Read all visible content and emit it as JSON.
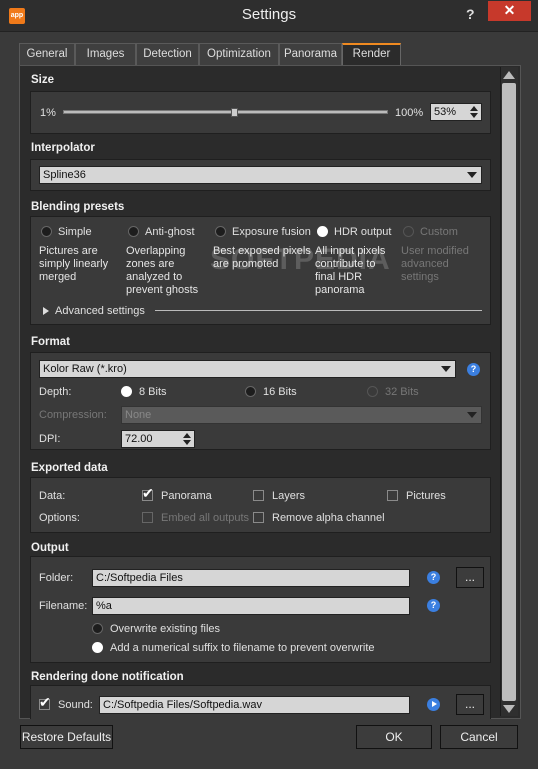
{
  "window": {
    "title": "Settings",
    "help": "?",
    "close": "✕",
    "icon": "app-icon",
    "icon_text": "app"
  },
  "tabs": [
    "General",
    "Images",
    "Detection",
    "Optimization",
    "Panorama",
    "Render"
  ],
  "active_tab": "Render",
  "watermark": "SOFTPEDIA",
  "size": {
    "title": "Size",
    "min_label": "1%",
    "max_label": "100%",
    "value": "53%",
    "level_percent": 53
  },
  "interpolator": {
    "title": "Interpolator",
    "selected": "Spline36"
  },
  "blending": {
    "title": "Blending presets",
    "options": [
      {
        "label": "Simple",
        "desc": [
          "Pictures are",
          "simply linearly",
          "merged"
        ]
      },
      {
        "label": "Anti-ghost",
        "desc": [
          "Overlapping",
          "zones are",
          "analyzed to",
          "prevent ghosts"
        ]
      },
      {
        "label": "Exposure fusion",
        "desc": [
          "Best exposed pixels",
          "are promoted"
        ]
      },
      {
        "label": "HDR output",
        "desc": [
          "All input pixels",
          "contribute to",
          "final HDR",
          "panorama"
        ]
      },
      {
        "label": "Custom",
        "desc": [
          "User modified",
          "advanced",
          "settings"
        ]
      }
    ],
    "selected": "HDR output",
    "advanced": "Advanced settings"
  },
  "format": {
    "title": "Format",
    "selected": "Kolor Raw (*.kro)",
    "depth_label": "Depth:",
    "depth_options": [
      "8 Bits",
      "16 Bits",
      "32 Bits"
    ],
    "depth_selected": "8 Bits",
    "compression_label": "Compression:",
    "compression_value": "None",
    "dpi_label": "DPI:",
    "dpi_value": "72.00"
  },
  "exported": {
    "title": "Exported data",
    "data_label": "Data:",
    "panorama": "Panorama",
    "layers": "Layers",
    "pictures": "Pictures",
    "options_label": "Options:",
    "embed": "Embed all outputs",
    "remove_alpha": "Remove alpha channel"
  },
  "output": {
    "title": "Output",
    "folder_label": "Folder:",
    "folder_value": "C:/Softpedia Files",
    "browse": "...",
    "filename_label": "Filename:",
    "filename_value": "%a",
    "overwrite": "Overwrite existing files",
    "suffix": "Add a numerical suffix to filename to prevent overwrite"
  },
  "notification": {
    "title": "Rendering done notification",
    "sound_label": "Sound:",
    "sound_value": "C:/Softpedia Files/Softpedia.wav",
    "browse": "..."
  },
  "buttons": {
    "restore": "Restore Defaults",
    "ok": "OK",
    "cancel": "Cancel"
  }
}
